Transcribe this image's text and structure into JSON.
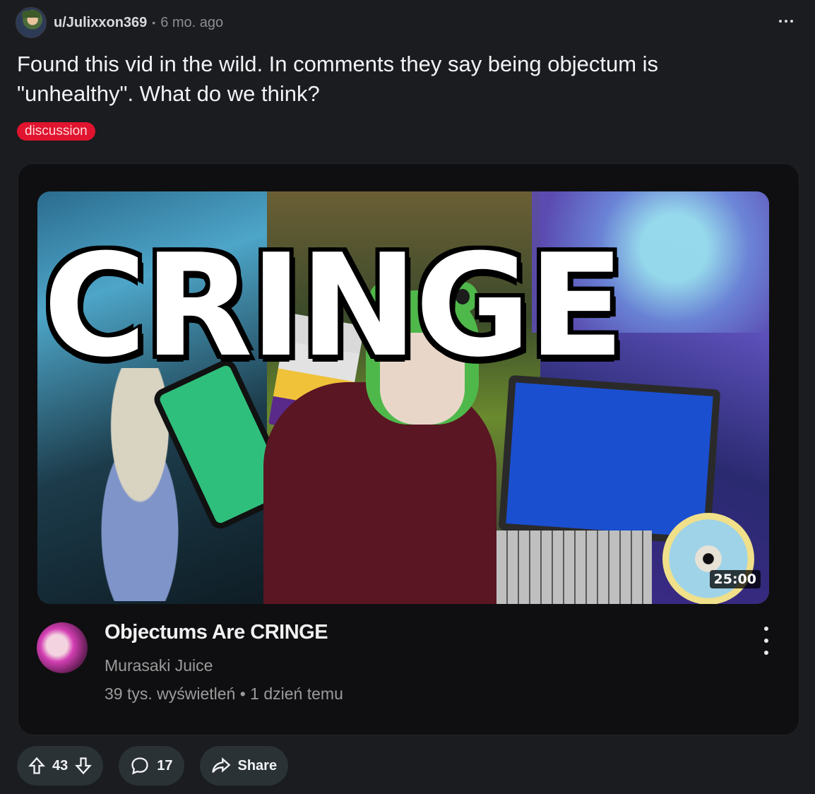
{
  "post": {
    "username": "u/Julixxon369",
    "separator": "•",
    "time": "6 mo. ago",
    "title": "Found this vid in the wild. In comments they say being objectum is\n\"unhealthy\". What do we think?",
    "flair": "discussion",
    "flair_color": "#e0142e"
  },
  "media": {
    "thumbnail_text": "CRINGE",
    "duration": "25:00",
    "video_title": "Objectums Are CRINGE",
    "channel": "Murasaki Juice",
    "views_time": "39 tys. wyświetleń • 1 dzień temu"
  },
  "actions": {
    "upvotes": "43",
    "comments": "17",
    "share_label": "Share"
  },
  "icons": [
    "more-options-icon",
    "upvote-icon",
    "downvote-icon",
    "comment-icon",
    "share-icon",
    "video-more-icon"
  ]
}
